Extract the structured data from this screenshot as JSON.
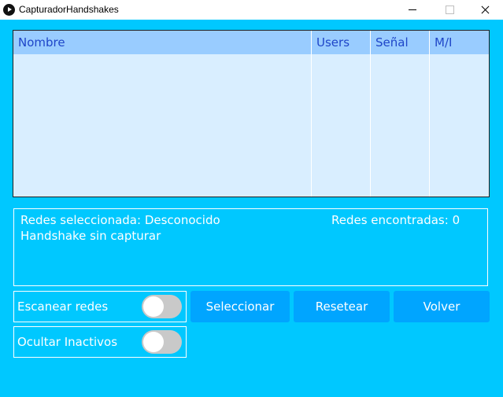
{
  "window": {
    "title": "CapturadorHandshakes",
    "icon": "play-icon"
  },
  "table": {
    "columns": [
      "Nombre",
      "Users",
      "Señal",
      "M/I"
    ],
    "rows": []
  },
  "info": {
    "selected_line": "Redes seleccionada: Desconocido",
    "found_line": "Redes encontradas: 0",
    "handshake_line": "Handshake sin capturar"
  },
  "toggles": [
    {
      "label": "Escanear redes",
      "on": false
    },
    {
      "label": "Ocultar Inactivos",
      "on": false
    }
  ],
  "buttons": {
    "select": "Seleccionar",
    "reset": "Resetear",
    "back": "Volver"
  },
  "colors": {
    "background": "#00c8ff",
    "table_header": "#99ccff",
    "table_body": "#d9eeff",
    "header_text": "#1f46c8",
    "button": "#00a5ff",
    "switch_off": "#c9c9c9"
  }
}
